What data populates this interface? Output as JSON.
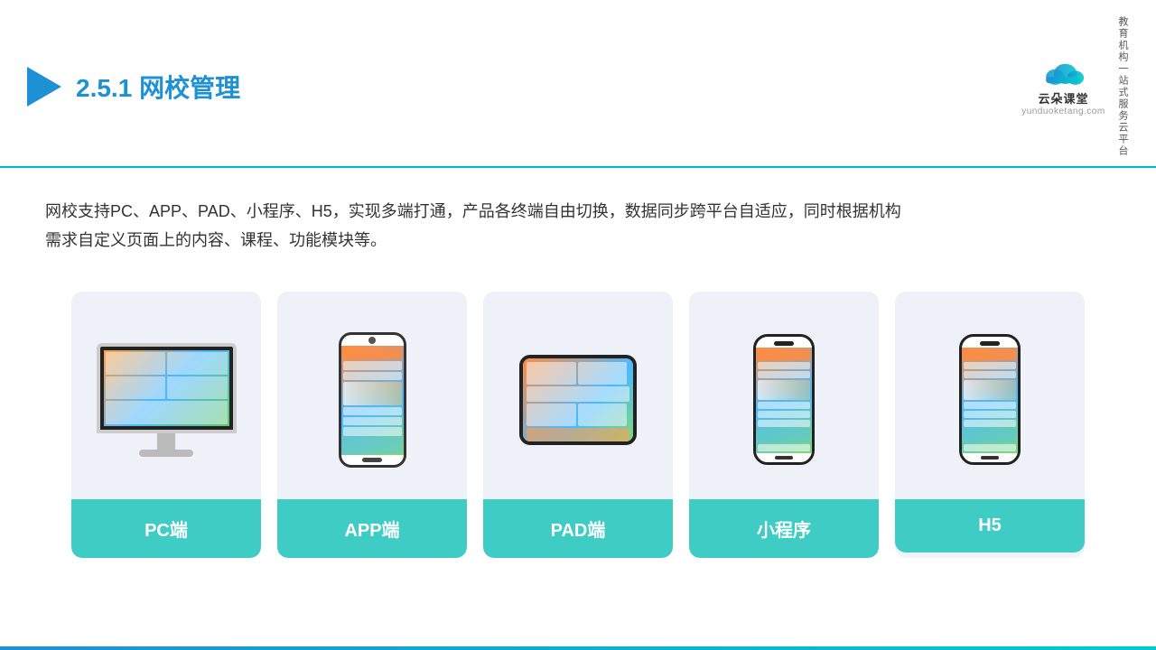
{
  "header": {
    "title_prefix": "2.5.1",
    "title_main": "网校管理",
    "logo_name": "云朵课堂",
    "logo_url": "yunduoketang.com",
    "logo_tagline": "教育机构一站式服务云平台"
  },
  "description": {
    "text_line1": "网校支持PC、APP、PAD、小程序、H5，实现多端打通，产品各终端自由切换，数据同步跨平台自适应，同时根据机构",
    "text_line2": "需求自定义页面上的内容、课程、功能模块等。"
  },
  "cards": [
    {
      "id": "pc",
      "label": "PC端"
    },
    {
      "id": "app",
      "label": "APP端"
    },
    {
      "id": "pad",
      "label": "PAD端"
    },
    {
      "id": "miniapp",
      "label": "小程序"
    },
    {
      "id": "h5",
      "label": "H5"
    }
  ]
}
